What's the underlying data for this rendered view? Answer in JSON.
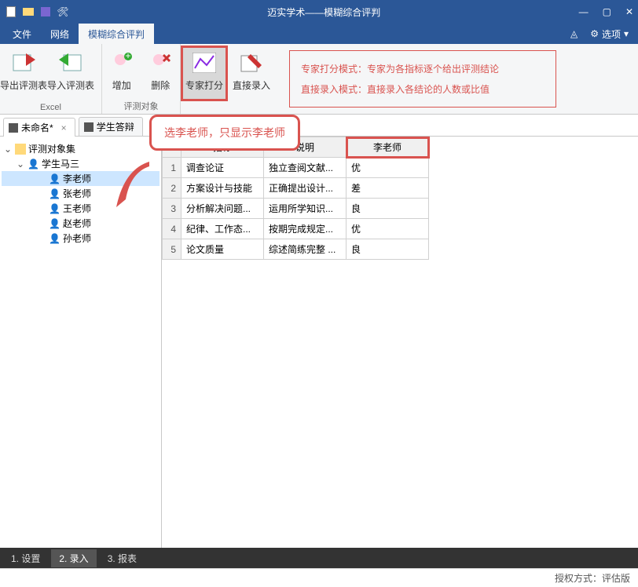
{
  "app": {
    "title": "迈实学术——模糊综合评判"
  },
  "menu": {
    "file": "文件",
    "network": "网络",
    "fuzzy": "模糊综合评判",
    "options": "选项"
  },
  "ribbon": {
    "export": "导出评测表",
    "import": "导入评测表",
    "add": "增加",
    "delete": "删除",
    "expert": "专家打分",
    "direct": "直接录入",
    "group1": "Excel",
    "group2": "评测对象",
    "mode1": "专家打分模式：专家为各指标逐个给出评测结论",
    "mode2": "直接录入模式：直接录入各结论的人数或比值"
  },
  "docs": {
    "t1": "未命名*",
    "t2": "学生答辩"
  },
  "tree": {
    "root": "评测对象集",
    "student": "学生马三",
    "li": "李老师",
    "zhang": "张老师",
    "wang": "王老师",
    "zhao": "赵老师",
    "sun": "孙老师"
  },
  "grid": {
    "h1": "指标",
    "h2": "说明",
    "h3": "李老师",
    "r1": {
      "n": "1",
      "a": "调查论证",
      "b": "独立查阅文献...",
      "c": "优"
    },
    "r2": {
      "n": "2",
      "a": "方案设计与技能",
      "b": "正确提出设计...",
      "c": "差"
    },
    "r3": {
      "n": "3",
      "a": "分析解决问题...",
      "b": "运用所学知识...",
      "c": "良"
    },
    "r4": {
      "n": "4",
      "a": "纪律、工作态...",
      "b": "按期完成规定...",
      "c": "优"
    },
    "r5": {
      "n": "5",
      "a": "论文质量",
      "b": "综述简练完整 ...",
      "c": "良"
    }
  },
  "callout": {
    "text": "选李老师，只显示李老师"
  },
  "bottom": {
    "t1": "1. 设置",
    "t2": "2. 录入",
    "t3": "3. 报表"
  },
  "status": {
    "license": "授权方式：评估版"
  }
}
